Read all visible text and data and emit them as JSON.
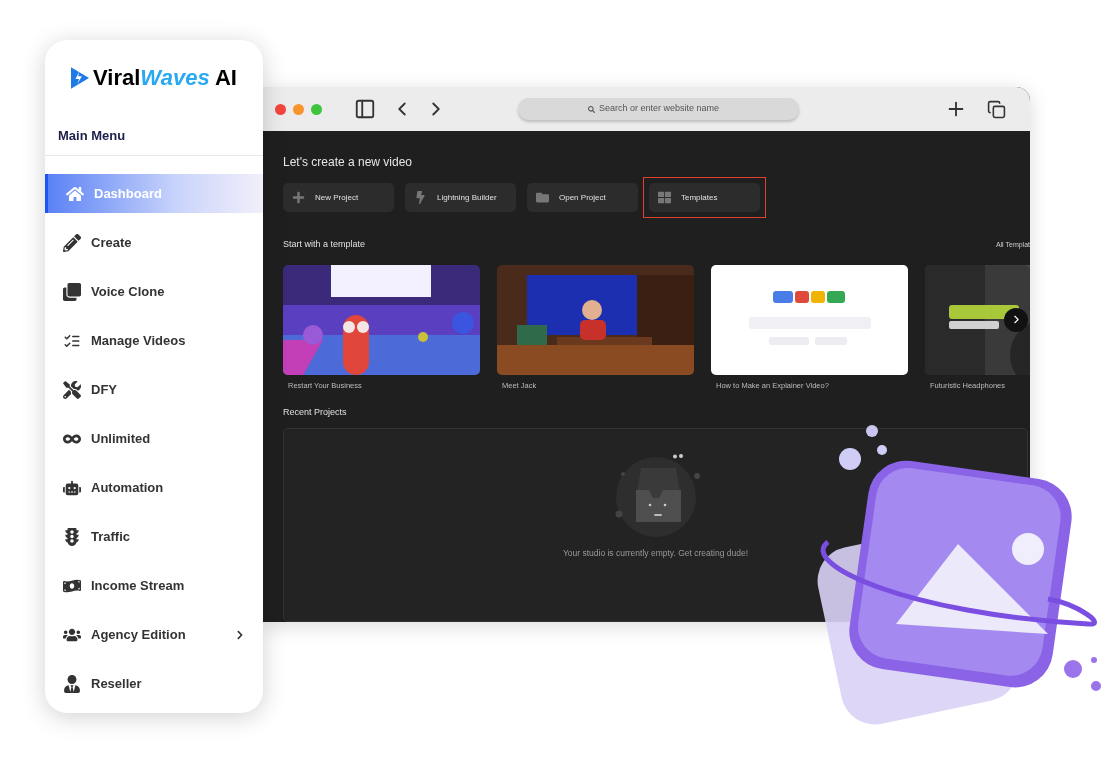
{
  "logo": {
    "parts": [
      "Viral",
      "Waves",
      "AI"
    ]
  },
  "sidebar": {
    "heading": "Main Menu",
    "items": [
      {
        "label": "Dashboard",
        "selected": true,
        "has_submenu": false
      },
      {
        "label": "Create",
        "selected": false,
        "has_submenu": false
      },
      {
        "label": "Voice Clone",
        "selected": false,
        "has_submenu": false
      },
      {
        "label": "Manage Videos",
        "selected": false,
        "has_submenu": false
      },
      {
        "label": "DFY",
        "selected": false,
        "has_submenu": false
      },
      {
        "label": "Unlimited",
        "selected": false,
        "has_submenu": false
      },
      {
        "label": "Automation",
        "selected": false,
        "has_submenu": false
      },
      {
        "label": "Traffic",
        "selected": false,
        "has_submenu": false
      },
      {
        "label": "Income Stream",
        "selected": false,
        "has_submenu": false
      },
      {
        "label": "Agency Edition",
        "selected": false,
        "has_submenu": true
      },
      {
        "label": "Reseller",
        "selected": false,
        "has_submenu": false
      }
    ]
  },
  "browser": {
    "address_bar": {
      "placeholder": "Search or enter website name"
    }
  },
  "studio": {
    "heading": "Let's create a new video",
    "actions": [
      {
        "label": "New Project",
        "selected": false
      },
      {
        "label": "Lightning Builder",
        "selected": false
      },
      {
        "label": "Open Project",
        "selected": false
      },
      {
        "label": "Templates",
        "selected": true
      }
    ],
    "templates_heading": "Start with a template",
    "all_templates_link": "All Templat",
    "templates": [
      {
        "title": "Restart Your Business",
        "kind": "picture"
      },
      {
        "title": "Meet Jack",
        "kind": "picture"
      },
      {
        "title": "How to Make an Explainer Video?",
        "kind": "picture"
      },
      {
        "title": "Futuristic Headphones",
        "kind": "picture"
      }
    ],
    "recent_heading": "Recent Projects",
    "empty_message": "Your studio is currently empty. Get creating dude!"
  }
}
